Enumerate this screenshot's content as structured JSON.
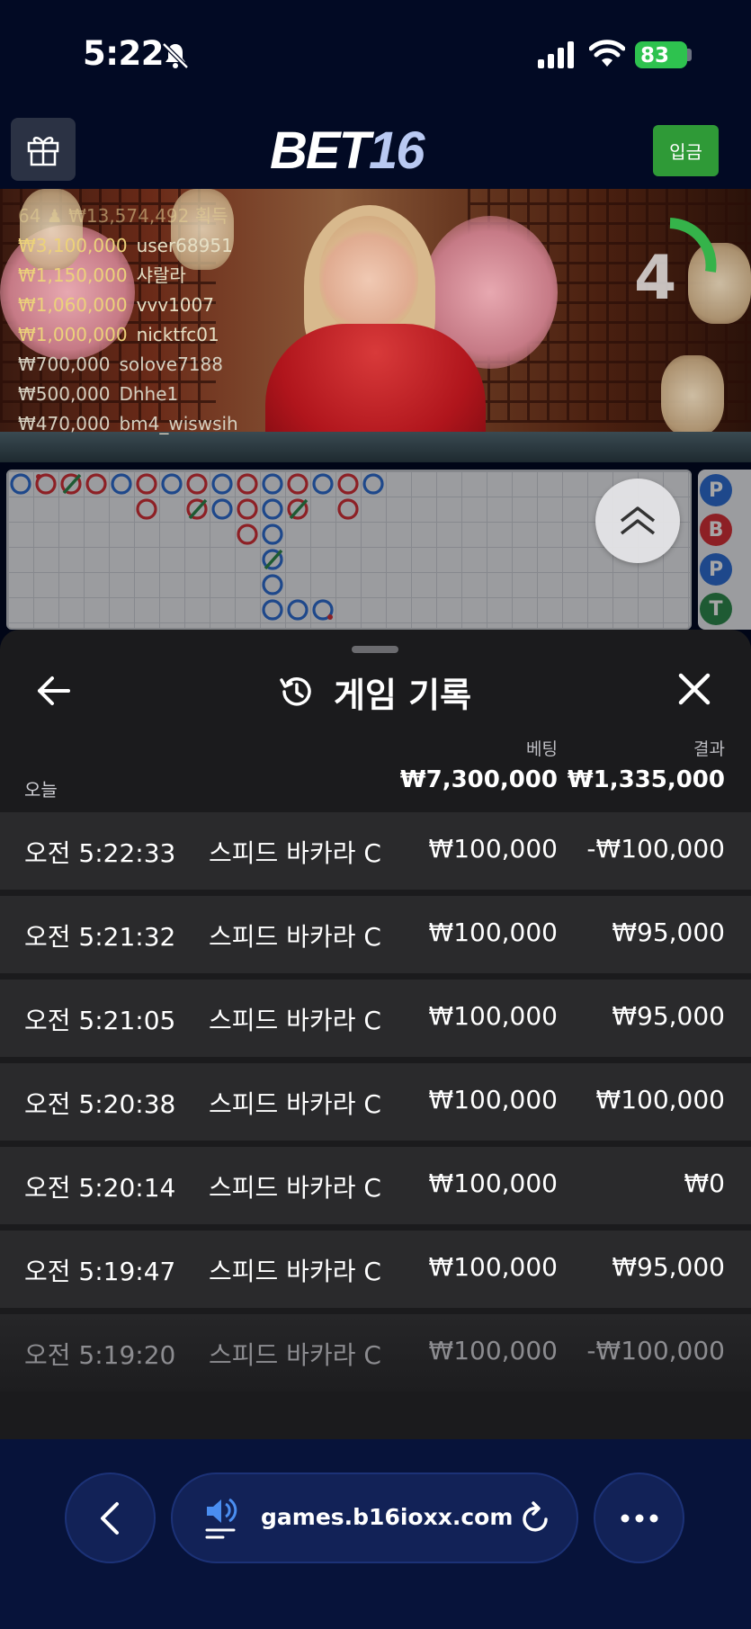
{
  "status_bar": {
    "time": "5:22",
    "battery": "83"
  },
  "header": {
    "logo_part1": "BET",
    "logo_part2": "16",
    "deposit_label": "입금"
  },
  "video": {
    "bet_summary": "64 ♟ ₩13,574,492 획득",
    "bets": [
      {
        "amount": "₩3,100,000",
        "user": "user68951"
      },
      {
        "amount": "₩1,150,000",
        "user": "샤랄라"
      },
      {
        "amount": "₩1,060,000",
        "user": "vvv1007"
      },
      {
        "amount": "₩1,000,000",
        "user": "nicktfc01"
      },
      {
        "amount": "₩700,000",
        "user": "solove7188"
      },
      {
        "amount": "₩500,000",
        "user": "Dhhe1"
      },
      {
        "amount": "₩470,000",
        "user": "bm4_wiswsih"
      }
    ],
    "timer": "4"
  },
  "side_predictions": [
    "P",
    "B",
    "P",
    "T"
  ],
  "sheet": {
    "title": "게임 기록",
    "col_bet": "베팅",
    "col_result": "결과",
    "today_label": "오늘",
    "today_bet": "₩7,300,000",
    "today_result": "₩1,335,000",
    "rows": [
      {
        "time": "오전 5:22:33",
        "game": "스피드 바카라 C",
        "bet": "₩100,000",
        "result": "-₩100,000"
      },
      {
        "time": "오전 5:21:32",
        "game": "스피드 바카라 C",
        "bet": "₩100,000",
        "result": "₩95,000"
      },
      {
        "time": "오전 5:21:05",
        "game": "스피드 바카라 C",
        "bet": "₩100,000",
        "result": "₩95,000"
      },
      {
        "time": "오전 5:20:38",
        "game": "스피드 바카라 C",
        "bet": "₩100,000",
        "result": "₩100,000"
      },
      {
        "time": "오전 5:20:14",
        "game": "스피드 바카라 C",
        "bet": "₩100,000",
        "result": "₩0"
      },
      {
        "time": "오전 5:19:47",
        "game": "스피드 바카라 C",
        "bet": "₩100,000",
        "result": "₩95,000"
      },
      {
        "time": "오전 5:19:20",
        "game": "스피드 바카라 C",
        "bet": "₩100,000",
        "result": "-₩100,000"
      }
    ]
  },
  "browser": {
    "url": "games.b16ioxx.com"
  },
  "colors": {
    "accent_green": "#2f9a37",
    "banker_red": "#d9323a",
    "player_blue": "#2f6fd6",
    "tie_green": "#2e8b4f"
  }
}
